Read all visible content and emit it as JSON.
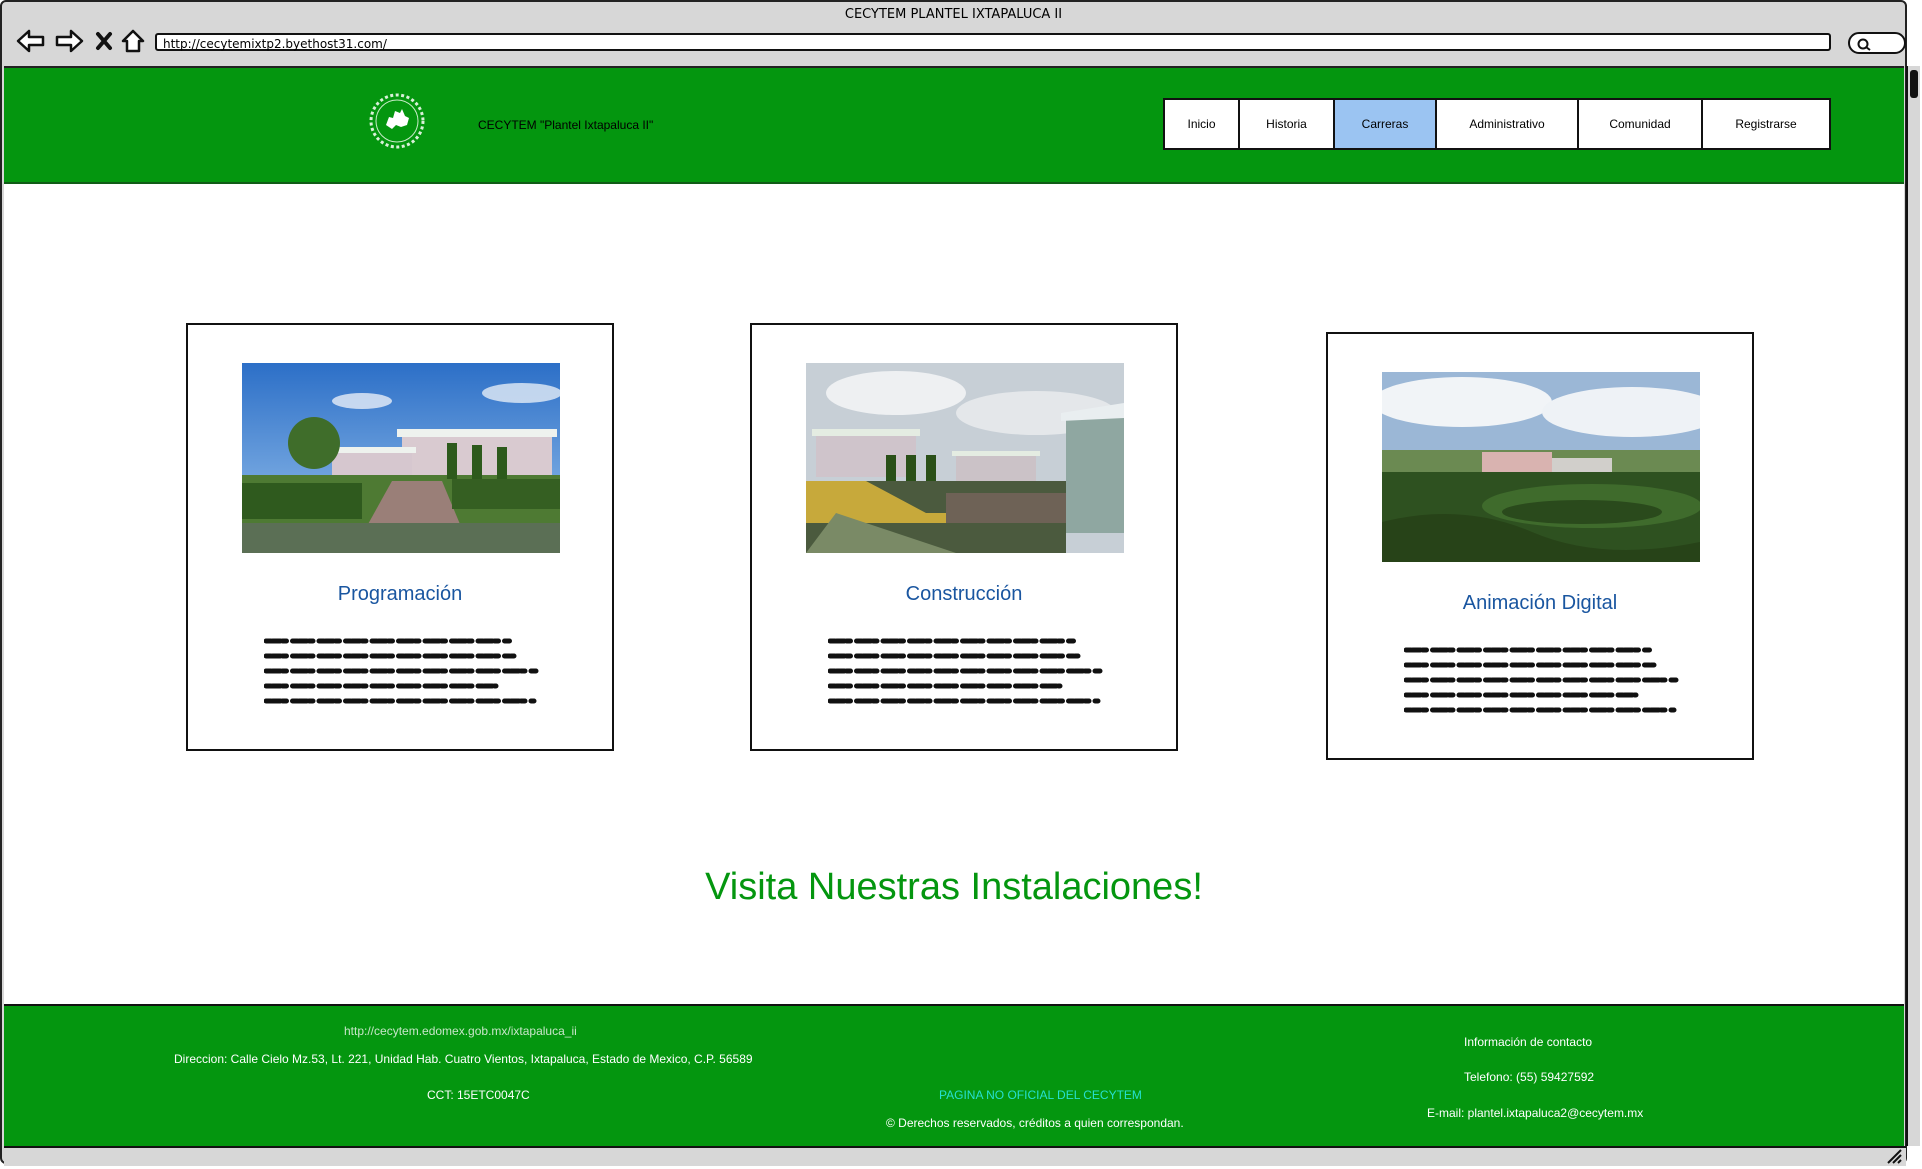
{
  "window": {
    "title": "CECYTEM PLANTEL IXTAPALUCA II"
  },
  "browser": {
    "url": "http://cecytemixtp2.byethost31.com/",
    "icons": [
      "back-arrow-icon",
      "forward-arrow-icon",
      "stop-icon",
      "home-icon",
      "search-icon"
    ]
  },
  "header": {
    "site_title": "CECYTEM \"Plantel Ixtapaluca II\"",
    "menu": [
      {
        "label": "Inicio"
      },
      {
        "label": "Historia"
      },
      {
        "label": "Carreras"
      },
      {
        "label": "Administrativo"
      },
      {
        "label": "Comunidad"
      },
      {
        "label": "Registrarse"
      }
    ],
    "active_menu": "Carreras"
  },
  "careers": [
    {
      "title": "Programación"
    },
    {
      "title": "Construcción"
    },
    {
      "title": "Animación Digital"
    }
  ],
  "cta": "Visita Nuestras Instalaciones!",
  "footer": {
    "website": "http://cecytem.edomex.gob.mx/ixtapaluca_ii",
    "address": "Direccion: Calle Cielo Mz.53, Lt. 221, Unidad Hab. Cuatro Vientos, Ixtapaluca, Estado de Mexico, C.P. 56589",
    "cct": "CCT: 15ETC0047C",
    "unofficial": "PAGINA NO OFICIAL DEL CECYTEM",
    "rights": "© Derechos reservados, créditos a quien correspondan.",
    "contact_title": "Información de contacto",
    "phone": "Telefono: (55) 59427592",
    "email": "E-mail: plantel.ixtapaluca2@cecytem.mx"
  },
  "colors": {
    "brand_green": "#04960f",
    "active_tab": "#9bc4f2",
    "career_title": "#1a56a0",
    "footer_link": "#c8e6c9",
    "unofficial_text": "#26e0d0"
  }
}
